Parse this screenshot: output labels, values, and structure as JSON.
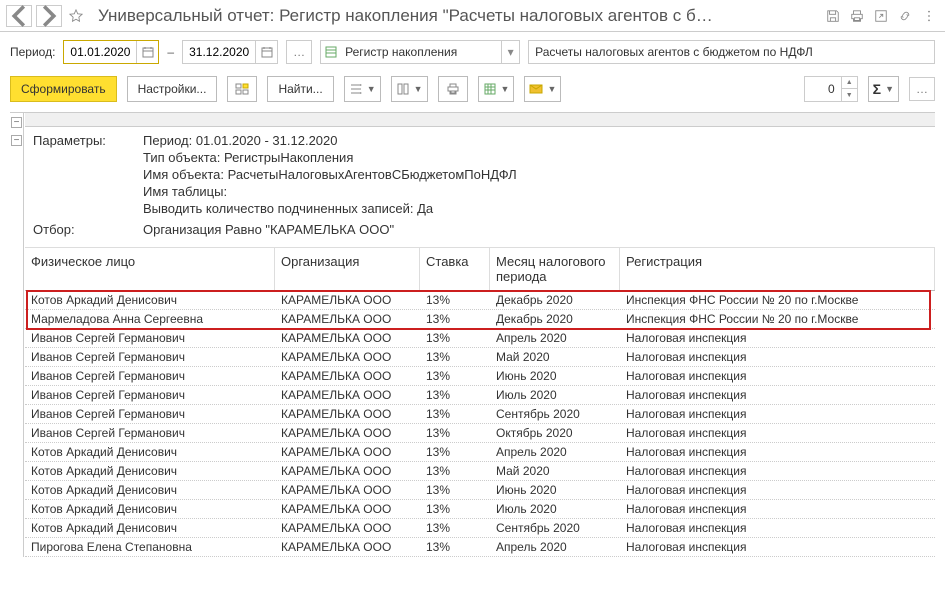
{
  "title": "Универсальный отчет: Регистр накопления \"Расчеты налоговых агентов с б…",
  "period": {
    "label": "Период:",
    "from": "01.01.2020",
    "to": "31.12.2020",
    "dash": "–"
  },
  "combo1": {
    "text": "Регистр накопления"
  },
  "combo2": {
    "text": "Расчеты налоговых агентов с бюджетом по НДФЛ"
  },
  "buttons": {
    "run": "Сформировать",
    "settings": "Настройки...",
    "find": "Найти...",
    "zero": "0"
  },
  "params": {
    "header": "Параметры:",
    "period": "Период: 01.01.2020 - 31.12.2020",
    "objtype": "Тип объекта: РегистрыНакопления",
    "objname": "Имя объекта: РасчетыНалоговыхАгентовСБюджетомПоНДФЛ",
    "tblname": "Имя таблицы:",
    "subcount": "Выводить количество подчиненных записей: Да",
    "filter_lbl": "Отбор:",
    "filter": "Организация Равно \"КАРАМЕЛЬКА ООО\""
  },
  "columns": {
    "name": "Физическое лицо",
    "org": "Организация",
    "rate": "Ставка",
    "month": "Месяц налогового периода",
    "reg": "Регистрация"
  },
  "rows": [
    {
      "name": "Котов Аркадий Денисович",
      "org": "КАРАМЕЛЬКА ООО",
      "rate": "13%",
      "month": "Декабрь 2020",
      "reg": "Инспекция ФНС России № 20 по г.Москве"
    },
    {
      "name": "Мармеладова Анна Сергеевна",
      "org": "КАРАМЕЛЬКА ООО",
      "rate": "13%",
      "month": "Декабрь 2020",
      "reg": "Инспекция ФНС России № 20 по г.Москве"
    },
    {
      "name": "Иванов Сергей Германович",
      "org": "КАРАМЕЛЬКА ООО",
      "rate": "13%",
      "month": "Апрель 2020",
      "reg": "Налоговая инспекция"
    },
    {
      "name": "Иванов Сергей Германович",
      "org": "КАРАМЕЛЬКА ООО",
      "rate": "13%",
      "month": "Май 2020",
      "reg": "Налоговая инспекция"
    },
    {
      "name": "Иванов Сергей Германович",
      "org": "КАРАМЕЛЬКА ООО",
      "rate": "13%",
      "month": "Июнь 2020",
      "reg": "Налоговая инспекция"
    },
    {
      "name": "Иванов Сергей Германович",
      "org": "КАРАМЕЛЬКА ООО",
      "rate": "13%",
      "month": "Июль 2020",
      "reg": "Налоговая инспекция"
    },
    {
      "name": "Иванов Сергей Германович",
      "org": "КАРАМЕЛЬКА ООО",
      "rate": "13%",
      "month": "Сентябрь 2020",
      "reg": "Налоговая инспекция"
    },
    {
      "name": "Иванов Сергей Германович",
      "org": "КАРАМЕЛЬКА ООО",
      "rate": "13%",
      "month": "Октябрь 2020",
      "reg": "Налоговая инспекция"
    },
    {
      "name": "Котов Аркадий Денисович",
      "org": "КАРАМЕЛЬКА ООО",
      "rate": "13%",
      "month": "Апрель 2020",
      "reg": "Налоговая инспекция"
    },
    {
      "name": "Котов Аркадий Денисович",
      "org": "КАРАМЕЛЬКА ООО",
      "rate": "13%",
      "month": "Май 2020",
      "reg": "Налоговая инспекция"
    },
    {
      "name": "Котов Аркадий Денисович",
      "org": "КАРАМЕЛЬКА ООО",
      "rate": "13%",
      "month": "Июнь 2020",
      "reg": "Налоговая инспекция"
    },
    {
      "name": "Котов Аркадий Денисович",
      "org": "КАРАМЕЛЬКА ООО",
      "rate": "13%",
      "month": "Июль 2020",
      "reg": "Налоговая инспекция"
    },
    {
      "name": "Котов Аркадий Денисович",
      "org": "КАРАМЕЛЬКА ООО",
      "rate": "13%",
      "month": "Сентябрь 2020",
      "reg": "Налоговая инспекция"
    },
    {
      "name": "Пирогова Елена Степановна",
      "org": "КАРАМЕЛЬКА ООО",
      "rate": "13%",
      "month": "Апрель 2020",
      "reg": "Налоговая инспекция"
    }
  ]
}
